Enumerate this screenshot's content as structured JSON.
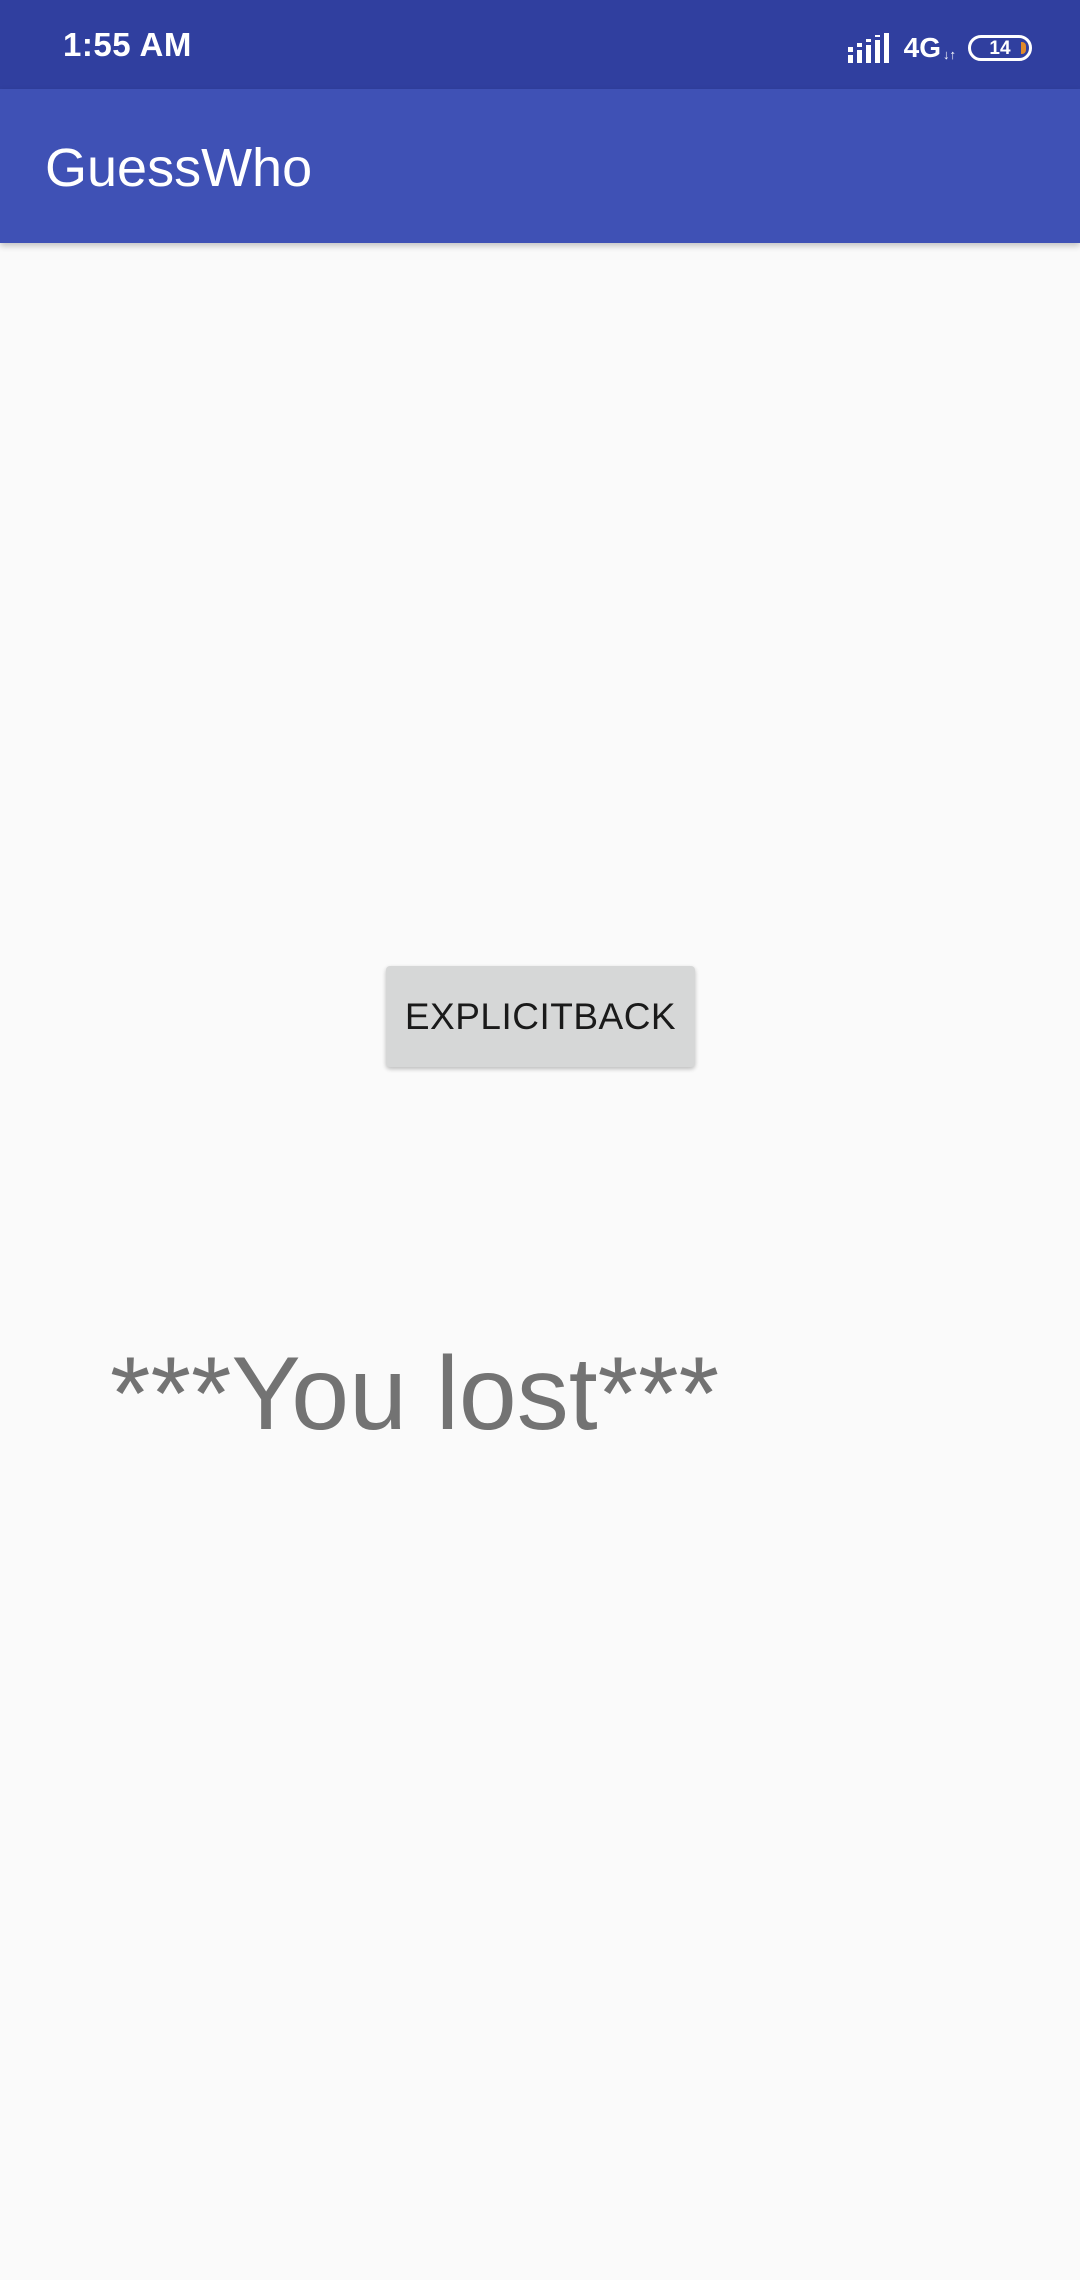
{
  "status_bar": {
    "time": "1:55 AM",
    "network": "4G",
    "network_sub": "↓↑",
    "battery_level": "14",
    "icons": [
      "signal-icon",
      "battery-icon"
    ]
  },
  "app_bar": {
    "title": "GuessWho"
  },
  "main": {
    "button_label": "EXPLICITBACK",
    "result_text": "***You lost***"
  },
  "colors": {
    "status_bar": "#303f9f",
    "app_bar": "#3f51b5",
    "background": "#fafafa",
    "button": "#d6d7d7",
    "result_text": "#737373"
  }
}
